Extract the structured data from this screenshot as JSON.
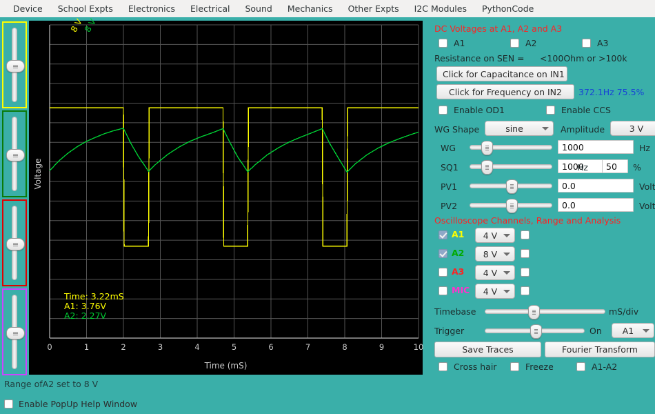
{
  "menubar": {
    "items": [
      {
        "label": "Device"
      },
      {
        "label": "School Expts"
      },
      {
        "label": "Electronics"
      },
      {
        "label": "Electrical"
      },
      {
        "label": "Sound"
      },
      {
        "label": "Mechanics"
      },
      {
        "label": "Other Expts"
      },
      {
        "label": "I2C Modules"
      },
      {
        "label": "PythonCode"
      }
    ]
  },
  "left_sliders": [
    {
      "name": "slider-a1",
      "color": "#ffff00",
      "value_pct": 50
    },
    {
      "name": "slider-a2",
      "color": "#0a7a0a",
      "value_pct": 50
    },
    {
      "name": "slider-a3",
      "color": "#e00000",
      "value_pct": 50
    },
    {
      "name": "slider-mic",
      "color": "#cc44ff",
      "value_pct": 50
    }
  ],
  "plot": {
    "xlabel": "Time (mS)",
    "ylabel": "Voltage",
    "xticks": [
      "0",
      "1",
      "2",
      "3",
      "4",
      "5",
      "6",
      "7",
      "8",
      "9",
      "10"
    ],
    "range_label_a1": "8 V",
    "range_label_a2": "8 V",
    "readout": {
      "time": "Time:  3.22mS",
      "a1": "A1:  3.76V",
      "a2": "A2:  2.27V"
    },
    "colors": {
      "a1": "#ffff00",
      "a2": "#00cc33",
      "grid": "#555555",
      "background": "#000000"
    }
  },
  "chart_data": {
    "type": "line",
    "title": "",
    "xlabel": "Time (mS)",
    "ylabel": "Voltage",
    "xlim": [
      0,
      10
    ],
    "ylim": [
      -8,
      8
    ],
    "grid": true,
    "legend": "none",
    "annotations": [
      "Time:  3.22mS",
      "A1:  3.76V",
      "A2:  2.27V",
      "8 V",
      "8 V"
    ],
    "series": [
      {
        "name": "A1",
        "color": "#ffff00",
        "type": "square-wave",
        "frequency_hz": 372.1,
        "duty_cycle_pct": 75.5,
        "high_v": 3.76,
        "low_v": -3.3,
        "points": [
          [
            0.0,
            3.76
          ],
          [
            2.0,
            3.76
          ],
          [
            2.02,
            -3.3
          ],
          [
            2.68,
            -3.3
          ],
          [
            2.7,
            3.76
          ],
          [
            4.7,
            3.76
          ],
          [
            4.72,
            -3.3
          ],
          [
            5.37,
            -3.3
          ],
          [
            5.39,
            3.76
          ],
          [
            7.39,
            3.76
          ],
          [
            7.41,
            -3.3
          ],
          [
            8.06,
            -3.3
          ],
          [
            8.08,
            3.76
          ],
          [
            10.0,
            3.76
          ]
        ]
      },
      {
        "name": "A2",
        "color": "#00cc33",
        "type": "rc-response",
        "points": [
          [
            0.0,
            0.55
          ],
          [
            0.25,
            1.05
          ],
          [
            0.5,
            1.45
          ],
          [
            0.75,
            1.78
          ],
          [
            1.0,
            2.05
          ],
          [
            1.25,
            2.26
          ],
          [
            1.5,
            2.45
          ],
          [
            1.75,
            2.6
          ],
          [
            2.0,
            2.72
          ],
          [
            2.2,
            1.95
          ],
          [
            2.4,
            1.3
          ],
          [
            2.68,
            0.52
          ],
          [
            2.9,
            0.92
          ],
          [
            3.2,
            1.38
          ],
          [
            3.5,
            1.75
          ],
          [
            3.8,
            2.05
          ],
          [
            4.1,
            2.28
          ],
          [
            4.4,
            2.48
          ],
          [
            4.7,
            2.7
          ],
          [
            4.9,
            1.95
          ],
          [
            5.1,
            1.25
          ],
          [
            5.37,
            0.5
          ],
          [
            5.6,
            0.9
          ],
          [
            5.9,
            1.36
          ],
          [
            6.2,
            1.72
          ],
          [
            6.5,
            2.02
          ],
          [
            6.8,
            2.26
          ],
          [
            7.1,
            2.48
          ],
          [
            7.39,
            2.7
          ],
          [
            7.6,
            1.92
          ],
          [
            7.82,
            1.22
          ],
          [
            8.06,
            0.48
          ],
          [
            8.3,
            0.92
          ],
          [
            8.6,
            1.36
          ],
          [
            8.9,
            1.7
          ],
          [
            9.2,
            1.98
          ],
          [
            9.5,
            2.2
          ],
          [
            9.8,
            2.4
          ],
          [
            10.0,
            2.52
          ]
        ]
      }
    ]
  },
  "dc_section": {
    "title": "DC Voltages at A1, A2 and A3",
    "channels": [
      {
        "label": "A1",
        "checked": false
      },
      {
        "label": "A2",
        "checked": false
      },
      {
        "label": "A3",
        "checked": false
      }
    ],
    "resistance_label": "Resistance on SEN =",
    "resistance_value": "<100Ohm  or  >100k",
    "capacitance_button": "Click for Capacitance on IN1",
    "frequency_button": "Click for Frequency on IN2",
    "frequency_value": "372.1Hz 75.5%",
    "enable_od1": "Enable OD1",
    "enable_od1_checked": false,
    "enable_ccs": "Enable CCS",
    "enable_ccs_checked": false
  },
  "generator": {
    "wg_shape_label": "WG Shape",
    "wg_shape_value": "sine",
    "amplitude_label": "Amplitude",
    "amplitude_value": "3 V",
    "rows": [
      {
        "label": "WG",
        "slider_pct": 20,
        "value": "1000",
        "unit": "Hz"
      },
      {
        "label": "SQ1",
        "slider_pct": 20,
        "value": "1000",
        "unit": "Hz",
        "value2": "50",
        "unit2": "%"
      },
      {
        "label": "PV1",
        "slider_pct": 50,
        "value": "0.0",
        "unit": "Volt"
      },
      {
        "label": "PV2",
        "slider_pct": 50,
        "value": "0.0",
        "unit": "Volt"
      }
    ]
  },
  "scope": {
    "title": "Oscilloscope Channels, Range and Analysis",
    "channels": [
      {
        "label": "A1",
        "color": "#ffff00",
        "checked": true,
        "range": "4 V",
        "extra_checked": false
      },
      {
        "label": "A2",
        "color": "#00aa00",
        "checked": true,
        "range": "8 V",
        "extra_checked": false
      },
      {
        "label": "A3",
        "color": "#ff2222",
        "checked": false,
        "range": "4 V",
        "extra_checked": false
      },
      {
        "label": "MIC",
        "color": "#ff33cc",
        "checked": false,
        "range": "4 V",
        "extra_checked": false
      }
    ],
    "timebase_label": "Timebase",
    "timebase_unit": "mS/div",
    "timebase_pct": 40,
    "trigger_label": "Trigger",
    "trigger_on_label": "On",
    "trigger_source": "A1",
    "trigger_pct": 50,
    "save_traces_button": "Save Traces",
    "fourier_button": "Fourier Transform",
    "cross_hair": "Cross hair",
    "cross_hair_checked": false,
    "freeze": "Freeze",
    "freeze_checked": false,
    "a1_minus_a2": "A1-A2",
    "a1_minus_a2_checked": false
  },
  "statusbar": {
    "message": "Range ofA2 set to 8 V",
    "help_checkbox_label": "Enable PopUp Help Window",
    "help_checkbox_checked": false
  }
}
